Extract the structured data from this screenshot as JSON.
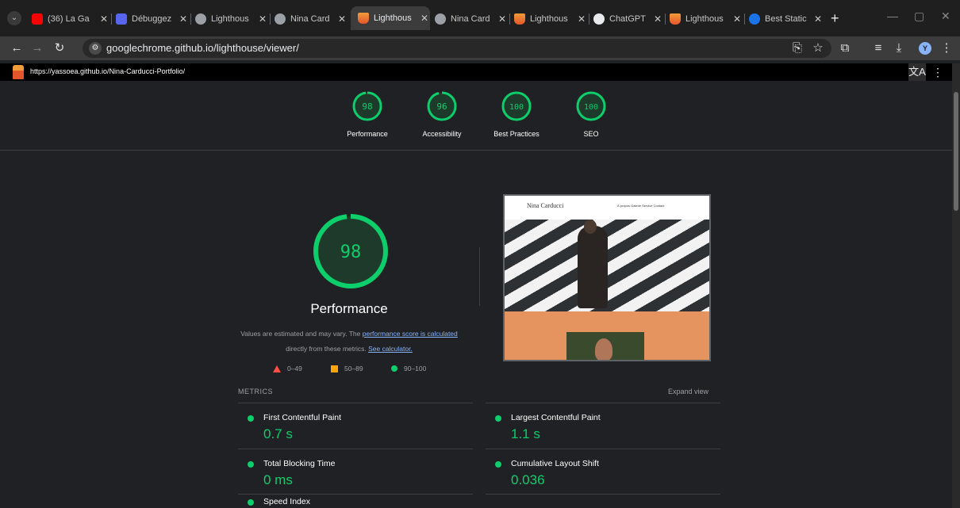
{
  "browser": {
    "tabs": [
      {
        "title": "(36) La Ga",
        "favicon": "youtube-icon",
        "active": false
      },
      {
        "title": "Débuggez",
        "favicon": "debugger-icon",
        "active": false
      },
      {
        "title": "Lighthous",
        "favicon": "globe-icon",
        "active": false
      },
      {
        "title": "Nina Card",
        "favicon": "globe-icon",
        "active": false
      },
      {
        "title": "Lighthous",
        "favicon": "lighthouse-icon",
        "active": true
      },
      {
        "title": "Nina Card",
        "favicon": "globe-icon",
        "active": false
      },
      {
        "title": "Lighthous",
        "favicon": "lighthouse-icon",
        "active": false
      },
      {
        "title": "ChatGPT",
        "favicon": "chatgpt-icon",
        "active": false
      },
      {
        "title": "Lighthous",
        "favicon": "lighthouse-icon",
        "active": false
      },
      {
        "title": "Best Static",
        "favicon": "c-icon",
        "active": false
      }
    ],
    "address": "googlechrome.github.io/lighthouse/viewer/",
    "profile_initial": "Y"
  },
  "lighthouse": {
    "report_url": "https://yassoea.github.io/Nina-Carducci-Portfolio/",
    "categories": [
      {
        "score": 98,
        "label": "Performance",
        "color": "#0cce6b"
      },
      {
        "score": 96,
        "label": "Accessibility",
        "color": "#0cce6b"
      },
      {
        "score": 100,
        "label": "Best Practices",
        "color": "#0cce6b"
      },
      {
        "score": 100,
        "label": "SEO",
        "color": "#0cce6b"
      }
    ],
    "performance": {
      "score": 98,
      "title": "Performance",
      "desc_pre": "Values are estimated and may vary. The ",
      "desc_link1": "performance score is calculated",
      "desc_mid": " directly from these metrics. ",
      "desc_link2": "See calculator."
    },
    "legend": [
      {
        "shape": "triangle",
        "range": "0–49",
        "color": "#ff4e42"
      },
      {
        "shape": "square",
        "range": "50–89",
        "color": "#ffa400"
      },
      {
        "shape": "circle",
        "range": "90–100",
        "color": "#0cce6b"
      }
    ],
    "thumbnail": {
      "brand": "Nina Carducci",
      "nav": "À propos   Galerie   Service   Contact"
    },
    "metrics_header": "METRICS",
    "expand_view": "Expand view",
    "metrics": [
      {
        "name": "First Contentful Paint",
        "value": "0.7 s"
      },
      {
        "name": "Largest Contentful Paint",
        "value": "1.1 s"
      },
      {
        "name": "Total Blocking Time",
        "value": "0 ms"
      },
      {
        "name": "Cumulative Layout Shift",
        "value": "0.036"
      },
      {
        "name": "Speed Index",
        "value": ""
      }
    ]
  },
  "colors": {
    "pass": "#0cce6b",
    "average": "#ffa400",
    "fail": "#ff4e42",
    "link": "#8ab4f8"
  }
}
